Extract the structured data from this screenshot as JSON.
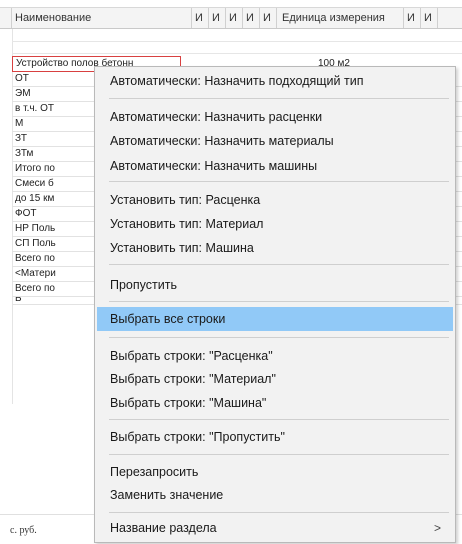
{
  "grid": {
    "headers": {
      "name": "Наименование",
      "i1": "И",
      "i2": "И",
      "i3": "И",
      "i4": "И",
      "i5": "И",
      "unit": "Единица измерения",
      "i6": "И",
      "i7": "И"
    },
    "selected_row": {
      "name": "Устройство полов бетонн",
      "unit": "100 м2"
    },
    "rows": [
      "ОТ",
      "ЭМ",
      "в т.ч. ОТ",
      "М",
      "ЗТ",
      "ЗТм",
      "Итого по",
      "Смеси б",
      "до 15 км",
      "ФОТ",
      "НР Поль",
      "СП Поль",
      "Всего по",
      "<Матери",
      "Всего по",
      "Б"
    ],
    "footer_left": "с. руб.",
    "footer_right": ")"
  },
  "context_menu": {
    "items": [
      {
        "label": "Автоматически: Назначить подходящий тип"
      },
      {
        "label": "Автоматически: Назначить расценки"
      },
      {
        "label": "Автоматически: Назначить материалы"
      },
      {
        "label": "Автоматически: Назначить машины"
      },
      {
        "label": "Установить тип: Расценка"
      },
      {
        "label": "Установить тип: Материал"
      },
      {
        "label": "Установить тип: Машина"
      },
      {
        "label": "Пропустить"
      },
      {
        "label": "Выбрать все строки"
      },
      {
        "label": "Выбрать строки: \"Расценка\""
      },
      {
        "label": "Выбрать строки: \"Материал\""
      },
      {
        "label": "Выбрать строки: \"Машина\""
      },
      {
        "label": "Выбрать строки: \"Пропустить\""
      },
      {
        "label": "Перезапросить"
      },
      {
        "label": "Заменить значение"
      },
      {
        "label": "Название раздела",
        "submenu_arrow": ">"
      }
    ],
    "highlighted_item": "Выбрать все строки",
    "highlight_color": "#91c9f7"
  }
}
